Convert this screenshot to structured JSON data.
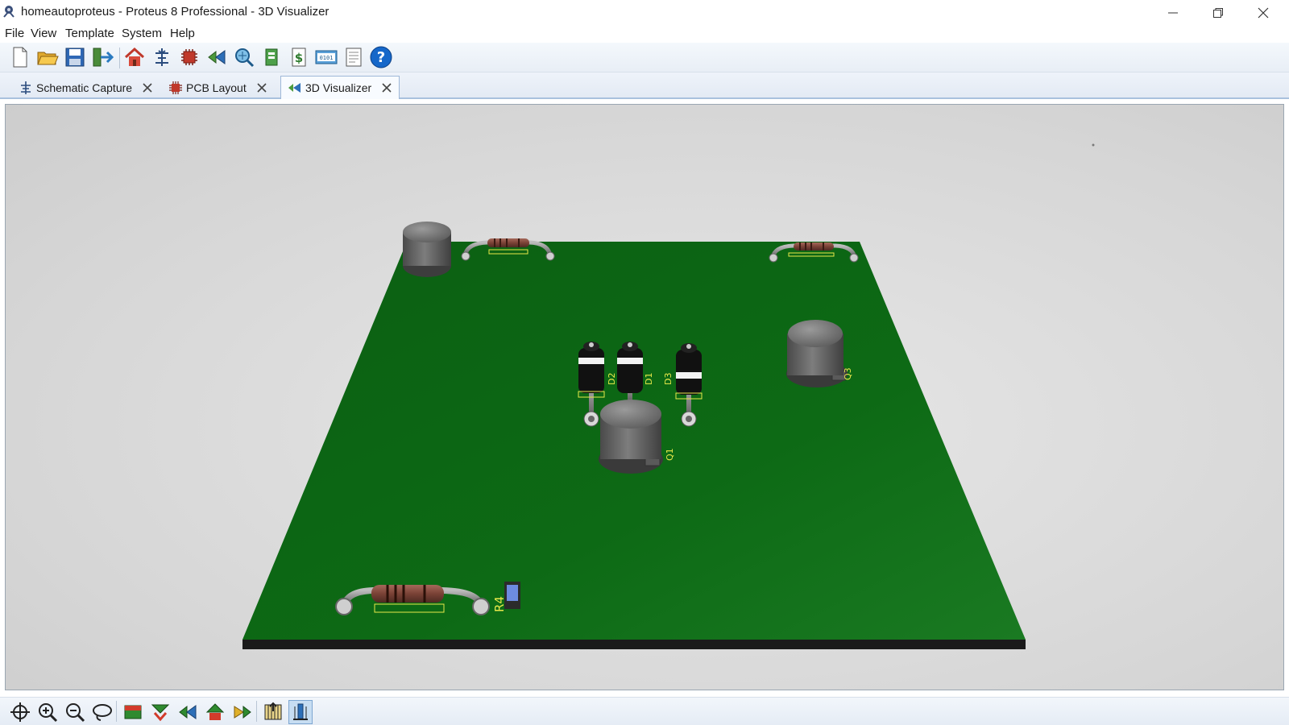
{
  "window": {
    "title": "homeautoproteus - Proteus 8 Professional - 3D Visualizer"
  },
  "menu": [
    "File",
    "View",
    "Template",
    "System",
    "Help"
  ],
  "tabs": [
    {
      "label": "Schematic Capture",
      "icon": "schematic-icon",
      "active": false
    },
    {
      "label": "PCB Layout",
      "icon": "pcb-chip-icon",
      "active": false
    },
    {
      "label": "3D Visualizer",
      "icon": "visualizer-icon",
      "active": true
    }
  ],
  "board_labels": {
    "d1": "D1",
    "d2": "D2",
    "d3": "D3",
    "q1": "Q1",
    "q3": "Q3",
    "r4": "R4"
  },
  "colors": {
    "board": "#0f6e16",
    "board_edge": "#1a1a1a",
    "silkscreen": "#e8e84a",
    "background": "#d6d6d6"
  }
}
